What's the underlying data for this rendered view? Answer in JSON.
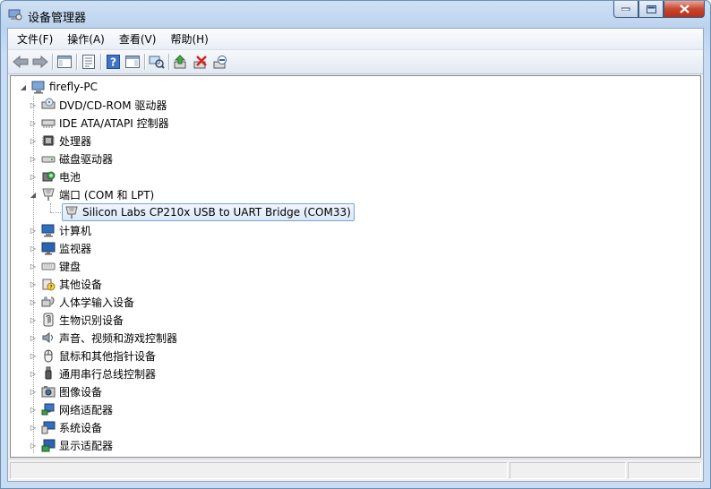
{
  "window": {
    "title": "设备管理器"
  },
  "menubar": [
    {
      "label": "文件(F)"
    },
    {
      "label": "操作(A)"
    },
    {
      "label": "查看(V)"
    },
    {
      "label": "帮助(H)"
    }
  ],
  "toolbar": [
    {
      "icon": "back-arrow-icon"
    },
    {
      "icon": "forward-arrow-icon"
    },
    {
      "icon": "show-hide-console-tree-icon"
    },
    {
      "icon": "properties-icon"
    },
    {
      "icon": "help-icon"
    },
    {
      "icon": "action-pane-icon"
    },
    {
      "icon": "scan-hardware-changes-icon"
    },
    {
      "icon": "update-driver-icon"
    },
    {
      "icon": "uninstall-icon"
    },
    {
      "icon": "disable-device-icon"
    }
  ],
  "tree": {
    "root": {
      "label": "firefly-PC",
      "icon": "computer-icon"
    },
    "categories": [
      {
        "label": "DVD/CD-ROM 驱动器",
        "icon": "dvd-drive-icon"
      },
      {
        "label": "IDE ATA/ATAPI 控制器",
        "icon": "ide-controller-icon"
      },
      {
        "label": "处理器",
        "icon": "processor-icon"
      },
      {
        "label": "磁盘驱动器",
        "icon": "disk-drive-icon"
      },
      {
        "label": "电池",
        "icon": "battery-icon"
      },
      {
        "label": "端口 (COM 和 LPT)",
        "icon": "port-icon",
        "expanded": true,
        "children": [
          {
            "label": "Silicon Labs CP210x USB to UART Bridge (COM33)",
            "icon": "port-icon",
            "selected": true
          }
        ]
      },
      {
        "label": "计算机",
        "icon": "computer-icon"
      },
      {
        "label": "监视器",
        "icon": "monitor-icon"
      },
      {
        "label": "键盘",
        "icon": "keyboard-icon"
      },
      {
        "label": "其他设备",
        "icon": "other-devices-icon"
      },
      {
        "label": "人体学输入设备",
        "icon": "hid-icon"
      },
      {
        "label": "生物识别设备",
        "icon": "biometric-icon"
      },
      {
        "label": "声音、视频和游戏控制器",
        "icon": "sound-icon"
      },
      {
        "label": "鼠标和其他指针设备",
        "icon": "mouse-icon"
      },
      {
        "label": "通用串行总线控制器",
        "icon": "usb-icon"
      },
      {
        "label": "图像设备",
        "icon": "camera-icon"
      },
      {
        "label": "网络适配器",
        "icon": "network-adapter-icon"
      },
      {
        "label": "系统设备",
        "icon": "system-devices-icon"
      },
      {
        "label": "显示适配器",
        "icon": "display-adapter-icon"
      }
    ]
  }
}
